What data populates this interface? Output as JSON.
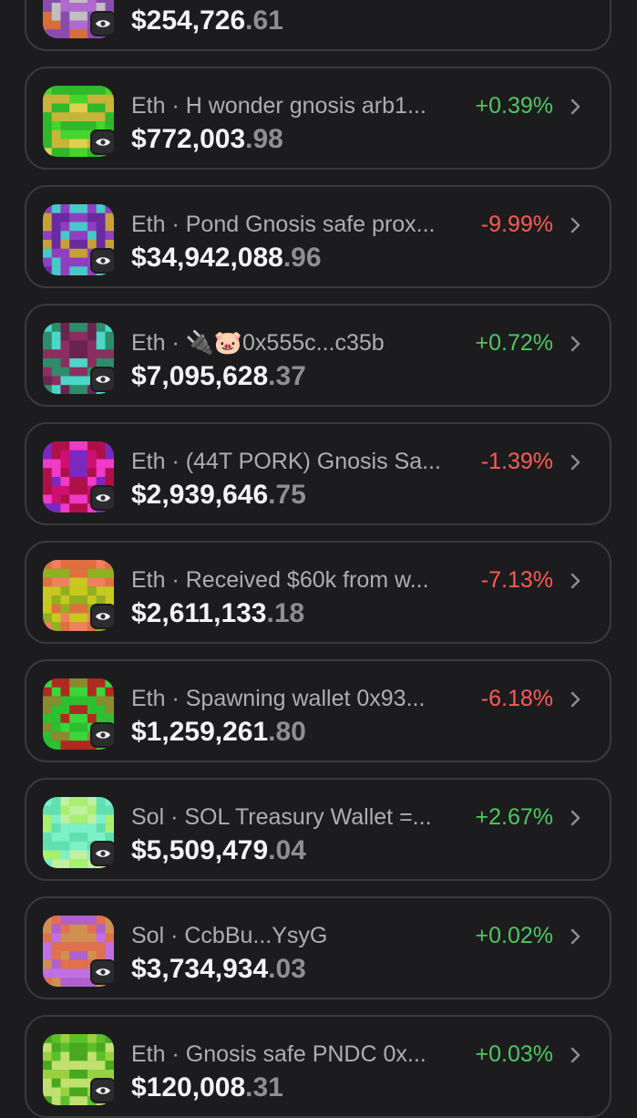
{
  "colors": {
    "background": "#1c1c1e",
    "card_border": "#3a3a3d",
    "positive": "#4cc85f",
    "negative": "#ff5a55",
    "secondary_text": "#aeaeb2",
    "cents_text": "#8e8e93"
  },
  "wallets": [
    {
      "chain": "",
      "name": "",
      "amount_whole": "$254,726",
      "amount_cents": ".61",
      "change": "",
      "trend": "",
      "avatar_colors": [
        "#b06ad0",
        "#d86f3a",
        "#8a4bb0",
        "#c0c0c0"
      ]
    },
    {
      "chain": "Eth",
      "name": "H wonder gnosis arb1...",
      "amount_whole": "$772,003",
      "amount_cents": ".98",
      "change": "+0.39%",
      "trend": "up",
      "avatar_colors": [
        "#44d62c",
        "#c9b43a",
        "#2fb82a",
        "#e0d050"
      ]
    },
    {
      "chain": "Eth",
      "name": "Pond Gnosis safe prox...",
      "amount_whole": "$34,942,088",
      "amount_cents": ".96",
      "change": "-9.99%",
      "trend": "down",
      "avatar_colors": [
        "#6a2aa0",
        "#c8a03a",
        "#46c9c9",
        "#8f3fc0"
      ]
    },
    {
      "chain": "Eth",
      "name": "0x555c...c35b",
      "emojis": "🔌🐷",
      "amount_whole": "$7,095,628",
      "amount_cents": ".37",
      "change": "+0.72%",
      "trend": "up",
      "avatar_colors": [
        "#6a2450",
        "#2e8c6a",
        "#4bd6c8",
        "#8a2f60"
      ]
    },
    {
      "chain": "Eth",
      "name": "(44T PORK) Gnosis Sa...",
      "amount_whole": "$2,939,646",
      "amount_cents": ".75",
      "change": "-1.39%",
      "trend": "down",
      "avatar_colors": [
        "#b0104a",
        "#f03ac8",
        "#7a28c0",
        "#d01070"
      ]
    },
    {
      "chain": "Eth",
      "name": "Received $60k from w...",
      "amount_whole": "$2,611,133",
      "amount_cents": ".18",
      "change": "-7.13%",
      "trend": "down",
      "avatar_colors": [
        "#c8c820",
        "#e07040",
        "#90b020",
        "#f08060"
      ]
    },
    {
      "chain": "Eth",
      "name": "Spawning wallet 0x93...",
      "amount_whole": "$1,259,261",
      "amount_cents": ".80",
      "change": "-6.18%",
      "trend": "down",
      "avatar_colors": [
        "#38d83a",
        "#8a8a30",
        "#b02a20",
        "#2cc030"
      ]
    },
    {
      "chain": "Sol",
      "name": "SOL Treasury Wallet =...",
      "amount_whole": "$5,509,479",
      "amount_cents": ".04",
      "change": "+2.67%",
      "trend": "up",
      "avatar_colors": [
        "#7ef0c8",
        "#a8f070",
        "#60e0b0",
        "#c0f0a0"
      ]
    },
    {
      "chain": "Sol",
      "name": "CcbBu...YsyG",
      "amount_whole": "$3,734,934",
      "amount_cents": ".03",
      "change": "+0.02%",
      "trend": "up",
      "avatar_colors": [
        "#b060d0",
        "#e07050",
        "#c070e0",
        "#d09050"
      ]
    },
    {
      "chain": "Eth",
      "name": "Gnosis safe PNDC 0x...",
      "amount_whole": "$120,008",
      "amount_cents": ".31",
      "change": "+0.03%",
      "trend": "up",
      "avatar_colors": [
        "#5cc02a",
        "#9ad040",
        "#48a820",
        "#c0e070"
      ]
    }
  ]
}
